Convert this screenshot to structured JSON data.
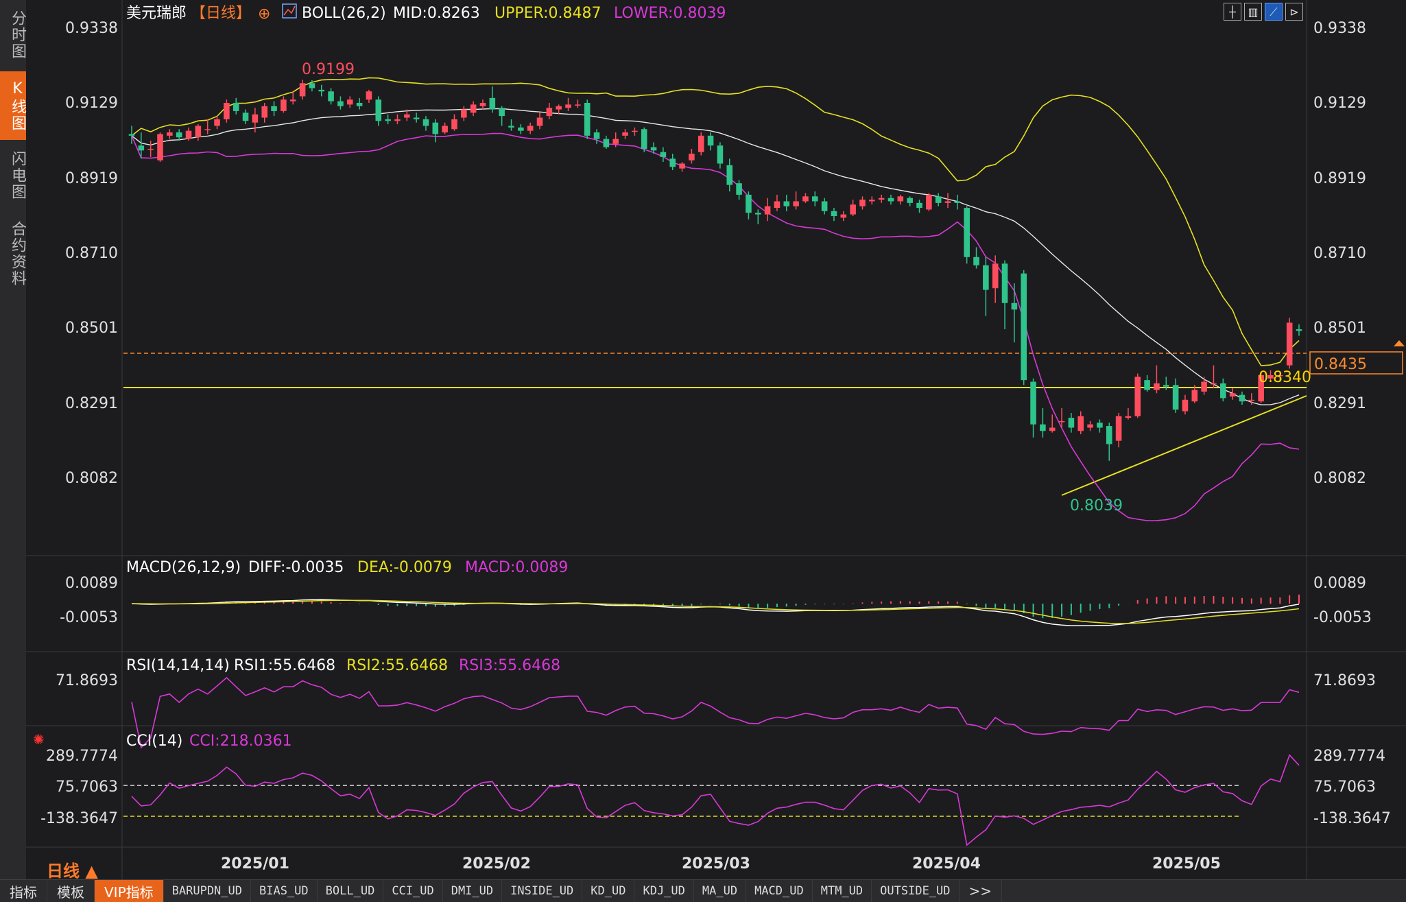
{
  "sidebar": {
    "tabs": [
      "分时图",
      "K线图",
      "闪电图",
      "合约资料"
    ],
    "active_index": 1
  },
  "header": {
    "symbol": "美元瑞郎",
    "period_tag": "【日线】",
    "indicator": "BOLL(26,2)",
    "mid": "MID:0.8263",
    "upper": "UPPER:0.8487",
    "lower": "LOWER:0.8039"
  },
  "toolbar_icons": [
    "crosshair-toggle",
    "k-chart-icon",
    "line-chart-icon",
    "replay-icon"
  ],
  "main_panel": {
    "y_ticks": [
      "0.9338",
      "0.9129",
      "0.8919",
      "0.8710",
      "0.8501",
      "0.8291",
      "0.8082"
    ],
    "last_price_label": "0.8435",
    "horizontal_line_label": "0.8340",
    "high_annotation": "0.9199",
    "low_annotation": "0.8039"
  },
  "macd_panel": {
    "title": "MACD(26,12,9)",
    "diff": "DIFF:-0.0035",
    "dea": "DEA:-0.0079",
    "macd": "MACD:0.0089",
    "y_ticks": [
      "0.0089",
      "-0.0053"
    ]
  },
  "rsi_panel": {
    "title": "RSI(14,14,14)",
    "rsi1": "RSI1:55.6468",
    "rsi2": "RSI2:55.6468",
    "rsi3": "RSI3:55.6468",
    "y_ticks": [
      "71.8693"
    ]
  },
  "cci_panel": {
    "title": "CCI(14)",
    "cci": "CCI:218.0361",
    "y_ticks": [
      "289.7774",
      "75.7063",
      "-138.3647"
    ]
  },
  "x_axis_labels": [
    "2025/01",
    "2025/02",
    "2025/03",
    "2025/04",
    "2025/05"
  ],
  "period_button": "日线 ▲",
  "bottom_tabs": [
    "指标",
    "模板",
    "VIP指标",
    "BARUPDN_UD",
    "BIAS_UD",
    "BOLL_UD",
    "CCI_UD",
    "DMI_UD",
    "INSIDE_UD",
    "KD_UD",
    "KDJ_UD",
    "MA_UD",
    "MACD_UD",
    "MTM_UD",
    "OUTSIDE_UD",
    ">>"
  ],
  "bottom_active_index": 2,
  "colors": {
    "up": "#ff4d5e",
    "down": "#2ec48c",
    "upper": "#e6e020",
    "mid": "#e8e8e8",
    "lower": "#d838d8",
    "accent": "#e8641a",
    "diff": "#ffffff",
    "dea": "#e6e020",
    "macd": "#d838d8",
    "cci": "#d838d8"
  },
  "chart_data": {
    "type": "candlestick",
    "symbol": "USDCHF",
    "interval": "daily",
    "price_range": [
      0.798,
      0.936
    ],
    "bars": [
      [
        0.9035,
        0.903,
        0.906,
        0.9005
      ],
      [
        0.9,
        0.8985,
        0.904,
        0.896
      ],
      [
        0.899,
        0.899,
        0.9015,
        0.8965
      ],
      [
        0.8955,
        0.9035,
        0.904,
        0.895
      ],
      [
        0.903,
        0.904,
        0.905,
        0.902
      ],
      [
        0.904,
        0.9025,
        0.905,
        0.9015
      ],
      [
        0.902,
        0.9045,
        0.9055,
        0.9015
      ],
      [
        0.9025,
        0.906,
        0.9065,
        0.9015
      ],
      [
        0.905,
        0.905,
        0.908,
        0.9035
      ],
      [
        0.906,
        0.908,
        0.909,
        0.905
      ],
      [
        0.908,
        0.913,
        0.914,
        0.907
      ],
      [
        0.913,
        0.9105,
        0.9145,
        0.9095
      ],
      [
        0.91,
        0.9075,
        0.911,
        0.9065
      ],
      [
        0.907,
        0.9095,
        0.9115,
        0.904
      ],
      [
        0.9085,
        0.912,
        0.913,
        0.907
      ],
      [
        0.912,
        0.9105,
        0.9135,
        0.909
      ],
      [
        0.9105,
        0.914,
        0.915,
        0.91
      ],
      [
        0.9135,
        0.914,
        0.9165,
        0.9125
      ],
      [
        0.915,
        0.919,
        0.92,
        0.914
      ],
      [
        0.919,
        0.9175,
        0.9199,
        0.9165
      ],
      [
        0.917,
        0.9165,
        0.9185,
        0.915
      ],
      [
        0.9165,
        0.9135,
        0.9175,
        0.9125
      ],
      [
        0.9135,
        0.912,
        0.915,
        0.911
      ],
      [
        0.9125,
        0.914,
        0.915,
        0.9115
      ],
      [
        0.913,
        0.912,
        0.9145,
        0.911
      ],
      [
        0.914,
        0.9165,
        0.917,
        0.913
      ],
      [
        0.914,
        0.9075,
        0.915,
        0.906
      ],
      [
        0.908,
        0.9075,
        0.9095,
        0.9065
      ],
      [
        0.9075,
        0.908,
        0.9095,
        0.9065
      ],
      [
        0.9085,
        0.9095,
        0.911,
        0.9075
      ],
      [
        0.9085,
        0.908,
        0.91,
        0.907
      ],
      [
        0.908,
        0.906,
        0.909,
        0.9045
      ],
      [
        0.907,
        0.9035,
        0.908,
        0.901
      ],
      [
        0.904,
        0.906,
        0.907,
        0.9035
      ],
      [
        0.905,
        0.908,
        0.9095,
        0.9045
      ],
      [
        0.9085,
        0.911,
        0.912,
        0.9075
      ],
      [
        0.91,
        0.9125,
        0.9135,
        0.909
      ],
      [
        0.912,
        0.913,
        0.914,
        0.911
      ],
      [
        0.9145,
        0.911,
        0.918,
        0.91
      ],
      [
        0.9115,
        0.909,
        0.912,
        0.906
      ],
      [
        0.906,
        0.9055,
        0.908,
        0.9045
      ],
      [
        0.9055,
        0.9045,
        0.9065,
        0.9035
      ],
      [
        0.9045,
        0.906,
        0.907,
        0.9035
      ],
      [
        0.906,
        0.9085,
        0.91,
        0.905
      ],
      [
        0.909,
        0.9115,
        0.913,
        0.908
      ],
      [
        0.911,
        0.912,
        0.9125,
        0.9095
      ],
      [
        0.9115,
        0.9125,
        0.9145,
        0.9105
      ],
      [
        0.9125,
        0.9125,
        0.914,
        0.9115
      ],
      [
        0.913,
        0.903,
        0.914,
        0.902
      ],
      [
        0.904,
        0.902,
        0.905,
        0.9005
      ],
      [
        0.902,
        0.8995,
        0.903,
        0.899
      ],
      [
        0.9005,
        0.902,
        0.904,
        0.8995
      ],
      [
        0.903,
        0.904,
        0.905,
        0.902
      ],
      [
        0.9045,
        0.9045,
        0.9055,
        0.903
      ],
      [
        0.905,
        0.899,
        0.9055,
        0.898
      ],
      [
        0.8995,
        0.8985,
        0.901,
        0.8975
      ],
      [
        0.898,
        0.8965,
        0.8995,
        0.895
      ],
      [
        0.896,
        0.8935,
        0.8975,
        0.8925
      ],
      [
        0.893,
        0.8945,
        0.895,
        0.892
      ],
      [
        0.8955,
        0.8975,
        0.899,
        0.8945
      ],
      [
        0.898,
        0.903,
        0.904,
        0.897
      ],
      [
        0.903,
        0.9,
        0.904,
        0.8985
      ],
      [
        0.9,
        0.8945,
        0.901,
        0.893
      ],
      [
        0.894,
        0.888,
        0.896,
        0.886
      ],
      [
        0.8885,
        0.885,
        0.8895,
        0.8835
      ],
      [
        0.885,
        0.8795,
        0.886,
        0.8775
      ],
      [
        0.8795,
        0.879,
        0.8805,
        0.876
      ],
      [
        0.879,
        0.8815,
        0.884,
        0.877
      ],
      [
        0.881,
        0.883,
        0.885,
        0.88
      ],
      [
        0.883,
        0.8815,
        0.885,
        0.88
      ],
      [
        0.8815,
        0.883,
        0.886,
        0.8805
      ],
      [
        0.883,
        0.8845,
        0.8855,
        0.8825
      ],
      [
        0.8845,
        0.883,
        0.886,
        0.8815
      ],
      [
        0.883,
        0.88,
        0.884,
        0.879
      ],
      [
        0.88,
        0.8785,
        0.881,
        0.877
      ],
      [
        0.878,
        0.879,
        0.88,
        0.877
      ],
      [
        0.879,
        0.882,
        0.8835,
        0.8785
      ],
      [
        0.8815,
        0.8835,
        0.8845,
        0.8805
      ],
      [
        0.883,
        0.8835,
        0.8845,
        0.882
      ],
      [
        0.8835,
        0.884,
        0.885,
        0.8825
      ],
      [
        0.884,
        0.883,
        0.885,
        0.882
      ],
      [
        0.883,
        0.8845,
        0.885,
        0.882
      ],
      [
        0.884,
        0.8825,
        0.8845,
        0.8815
      ],
      [
        0.8825,
        0.881,
        0.8835,
        0.8795
      ],
      [
        0.8805,
        0.885,
        0.8855,
        0.88
      ],
      [
        0.8845,
        0.8825,
        0.8855,
        0.8815
      ],
      [
        0.8825,
        0.883,
        0.8855,
        0.881
      ],
      [
        0.883,
        0.8825,
        0.885,
        0.8805
      ],
      [
        0.881,
        0.866,
        0.8815,
        0.864
      ],
      [
        0.866,
        0.8635,
        0.869,
        0.8625
      ],
      [
        0.8635,
        0.856,
        0.866,
        0.848
      ],
      [
        0.8565,
        0.864,
        0.8665,
        0.852
      ],
      [
        0.864,
        0.852,
        0.865,
        0.844
      ],
      [
        0.852,
        0.85,
        0.858,
        0.84
      ],
      [
        0.861,
        0.8285,
        0.862,
        0.827
      ],
      [
        0.828,
        0.815,
        0.829,
        0.811
      ],
      [
        0.815,
        0.813,
        0.82,
        0.811
      ],
      [
        0.813,
        0.814,
        0.818,
        0.8125
      ],
      [
        0.816,
        0.816,
        0.82,
        0.814
      ],
      [
        0.817,
        0.814,
        0.8185,
        0.8125
      ],
      [
        0.813,
        0.8175,
        0.819,
        0.812
      ],
      [
        0.814,
        0.815,
        0.816,
        0.813
      ],
      [
        0.8155,
        0.814,
        0.8165,
        0.8125
      ],
      [
        0.8145,
        0.809,
        0.8155,
        0.8039
      ],
      [
        0.81,
        0.8175,
        0.8185,
        0.808
      ],
      [
        0.817,
        0.8175,
        0.82,
        0.8165
      ],
      [
        0.8175,
        0.8295,
        0.8305,
        0.817
      ],
      [
        0.8285,
        0.8255,
        0.83,
        0.825
      ],
      [
        0.8255,
        0.8275,
        0.833,
        0.8245
      ],
      [
        0.827,
        0.8265,
        0.8295,
        0.8255
      ],
      [
        0.827,
        0.8195,
        0.829,
        0.8185
      ],
      [
        0.819,
        0.8225,
        0.824,
        0.818
      ],
      [
        0.822,
        0.8255,
        0.827,
        0.8215
      ],
      [
        0.825,
        0.828,
        0.8295,
        0.824
      ],
      [
        0.8275,
        0.8275,
        0.833,
        0.826
      ],
      [
        0.8275,
        0.823,
        0.829,
        0.822
      ],
      [
        0.8235,
        0.8245,
        0.826,
        0.8225
      ],
      [
        0.824,
        0.822,
        0.825,
        0.821
      ],
      [
        0.8225,
        0.8225,
        0.8245,
        0.821
      ],
      [
        0.822,
        0.83,
        0.831,
        0.8215
      ],
      [
        0.829,
        0.83,
        0.8315,
        0.828
      ],
      [
        0.83,
        0.83,
        0.831,
        0.828
      ],
      [
        0.833,
        0.846,
        0.8475,
        0.832
      ],
      [
        0.844,
        0.8435,
        0.8455,
        0.842
      ]
    ]
  }
}
